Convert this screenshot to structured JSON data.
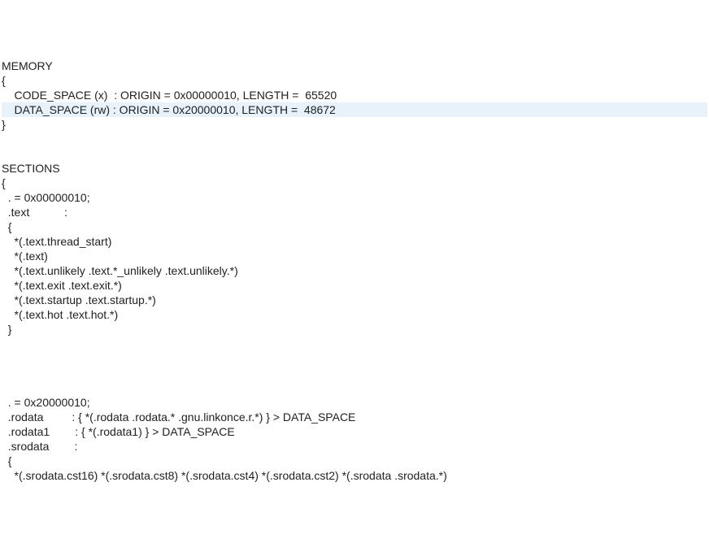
{
  "lines": [
    {
      "text": "MEMORY",
      "highlight": false
    },
    {
      "text": "{",
      "highlight": false
    },
    {
      "text": "    CODE_SPACE (x)  : ORIGIN = 0x00000010, LENGTH =  65520",
      "highlight": false
    },
    {
      "text": "    DATA_SPACE (rw) : ORIGIN = 0x20000010, LENGTH =  48672",
      "highlight": true
    },
    {
      "text": "}",
      "highlight": false
    },
    {
      "text": "",
      "highlight": false
    },
    {
      "text": "",
      "highlight": false
    },
    {
      "text": "SECTIONS",
      "highlight": false
    },
    {
      "text": "{",
      "highlight": false
    },
    {
      "text": "  . = 0x00000010;",
      "highlight": false
    },
    {
      "text": "  .text           :",
      "highlight": false
    },
    {
      "text": "  {",
      "highlight": false
    },
    {
      "text": "    *(.text.thread_start)",
      "highlight": false
    },
    {
      "text": "    *(.text)",
      "highlight": false
    },
    {
      "text": "    *(.text.unlikely .text.*_unlikely .text.unlikely.*)",
      "highlight": false
    },
    {
      "text": "    *(.text.exit .text.exit.*)",
      "highlight": false
    },
    {
      "text": "    *(.text.startup .text.startup.*)",
      "highlight": false
    },
    {
      "text": "    *(.text.hot .text.hot.*)",
      "highlight": false
    },
    {
      "text": "  }",
      "highlight": false
    },
    {
      "text": "",
      "highlight": false
    },
    {
      "text": "",
      "highlight": false
    },
    {
      "text": "",
      "highlight": false
    },
    {
      "text": "",
      "highlight": false
    },
    {
      "text": "  . = 0x20000010;",
      "highlight": false
    },
    {
      "text": "  .rodata         : { *(.rodata .rodata.* .gnu.linkonce.r.*) } > DATA_SPACE",
      "highlight": false
    },
    {
      "text": "  .rodata1        : { *(.rodata1) } > DATA_SPACE",
      "highlight": false
    },
    {
      "text": "  .srodata        :",
      "highlight": false
    },
    {
      "text": "  {",
      "highlight": false
    },
    {
      "text": "    *(.srodata.cst16) *(.srodata.cst8) *(.srodata.cst4) *(.srodata.cst2) *(.srodata .srodata.*)",
      "highlight": false
    }
  ]
}
